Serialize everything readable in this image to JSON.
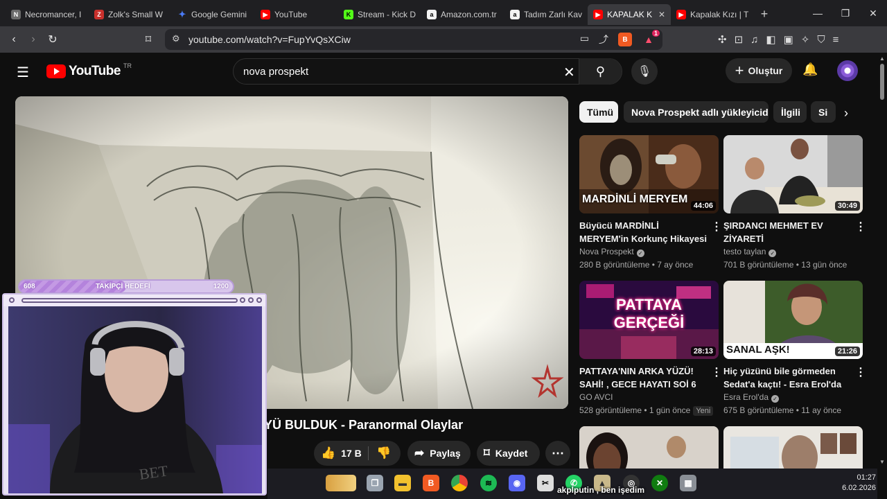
{
  "browser": {
    "tabs": [
      {
        "title": "Necromancer, I",
        "fav": "necro-icon",
        "color": "#6b6b6b"
      },
      {
        "title": "Zolk's Small W",
        "fav": "zolk-icon",
        "color": "#c9302c"
      },
      {
        "title": "Google Gemini",
        "fav": "gemini-icon",
        "color": "#4a7bf7"
      },
      {
        "title": "YouTube",
        "fav": "youtube-icon",
        "color": "#ff0000"
      },
      {
        "title": "Stream - Kick D",
        "fav": "kick-icon",
        "color": "#53fc18"
      },
      {
        "title": "Amazon.com.tr",
        "fav": "amazon-icon",
        "color": "#f2f2f2"
      },
      {
        "title": "Tadım Zarlı Kav",
        "fav": "amazon-icon",
        "color": "#f2f2f2"
      },
      {
        "title": "KAPALAK K",
        "fav": "youtube-icon",
        "color": "#ff0000",
        "active": true
      },
      {
        "title": "Kapalak Kızı | T",
        "fav": "youtube-icon",
        "color": "#ff0000"
      }
    ],
    "url": "youtube.com/watch?v=FupYvQsXCiw",
    "rewards_count": "1"
  },
  "youtube": {
    "logo_text": "YouTube",
    "logo_region": "TR",
    "search_query": "nova prospekt",
    "create_label": "Oluştur"
  },
  "player": {
    "title_visible": "YÜ BULDUK - Paranormal Olaylar",
    "likes": "17 B",
    "share_label": "Paylaş",
    "save_label": "Kaydet"
  },
  "stream_overlay": {
    "follow_current": "608",
    "follow_label": "TAKİPÇİ HEDEFİ",
    "follow_goal": "1200",
    "progress": 0.5,
    "chat_line": "akplputin , ben işedim"
  },
  "chips": [
    {
      "label": "Tümü",
      "active": true
    },
    {
      "label": "Nova Prospekt adlı yükleyiciden"
    },
    {
      "label": "İlgili"
    },
    {
      "label": "Si"
    }
  ],
  "recommendations": [
    {
      "title": "Büyücü MARDİNLİ MERYEM'in Korkunç Hikayesi | Evinde Bi...",
      "channel": "Nova Prospekt",
      "verified": true,
      "meta": "280 B görüntüleme • 7 ay önce",
      "duration": "44:06",
      "thumb_text": "MARDİNLİ MERYEM"
    },
    {
      "title": "ŞIRDANCI MEHMET EV ZİYARETİ",
      "channel": "testo taylan",
      "verified": true,
      "meta": "701 B görüntüleme • 13 gün önce",
      "duration": "30:49",
      "thumb_text": ""
    },
    {
      "title": "PATTAYA'NIN ARKA YÜZÜ! SAHİ! , GECE HAYATI SOİ 6",
      "channel": "GO AVCI",
      "verified": true,
      "meta": "528 görüntüleme • 1 gün önce",
      "badge": "Yeni",
      "duration": "28:13",
      "thumb_text": "PATTAYA GERÇEĞİ"
    },
    {
      "title": "Hiç yüzünü bile görmeden Sedat'a kaçtı! - Esra Erol'da",
      "channel": "Esra Erol'da",
      "verified": true,
      "meta": "675 B görüntüleme • 11 ay önce",
      "duration": "21:26",
      "thumb_text": "SANAL AŞK!"
    }
  ],
  "taskbar": {
    "time": "01:27",
    "date": "6.02.2026"
  }
}
